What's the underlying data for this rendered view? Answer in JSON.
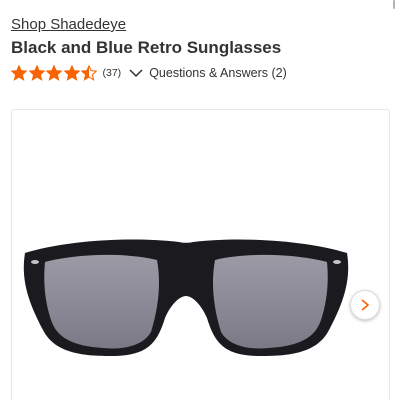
{
  "brand": {
    "link_text": "Shop Shadedeye"
  },
  "product": {
    "title": "Black and Blue Retro Sunglasses"
  },
  "rating": {
    "value": 4.5,
    "max": 5,
    "count_text": "(37)",
    "star_color": "#f96302"
  },
  "qa": {
    "label": "Questions & Answers (2)"
  },
  "gallery": {
    "current_image": "black-blue-retro-sunglasses-photo",
    "next_icon": "chevron-right-icon",
    "accent_color": "#f96302"
  }
}
